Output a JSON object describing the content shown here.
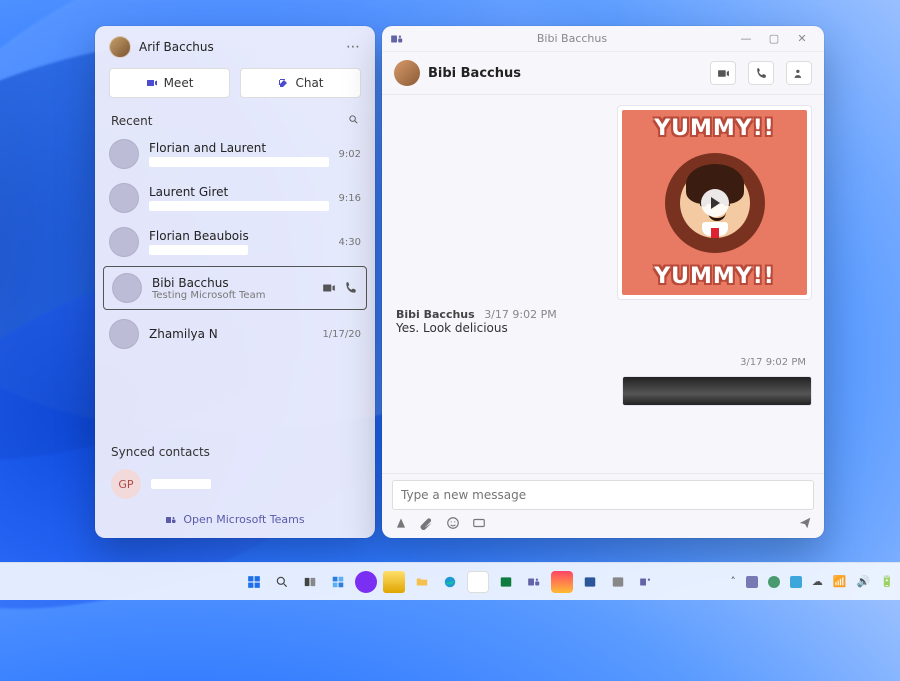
{
  "flyout": {
    "user_name": "Arif Bacchus",
    "meet_label": "Meet",
    "chat_label": "Chat",
    "recent_label": "Recent",
    "items": [
      {
        "name": "Florian and Laurent",
        "time": "9:02"
      },
      {
        "name": "Laurent Giret",
        "time": "9:16"
      },
      {
        "name": "Florian Beaubois",
        "time": "4:30"
      },
      {
        "name": "Bibi Bacchus",
        "sub": "Testing Microsoft Team",
        "time": ""
      },
      {
        "name": "Zhamilya N",
        "time": "1/17/20"
      }
    ],
    "synced_label": "Synced contacts",
    "contact_initials": "GP",
    "footer_label": "Open Microsoft Teams"
  },
  "chat": {
    "window_title": "Bibi Bacchus",
    "header_name": "Bibi Bacchus",
    "gif_text_top": "YUMMY!!",
    "gif_text_bottom": "YUMMY!!",
    "msg_author": "Bibi Bacchus",
    "msg_time": "3/17 9:02 PM",
    "msg_text": "Yes.  Look delicious",
    "reply_time": "3/17 9:02 PM",
    "compose_placeholder": "Type a new message"
  },
  "taskbar": {
    "time": "",
    "date": ""
  }
}
